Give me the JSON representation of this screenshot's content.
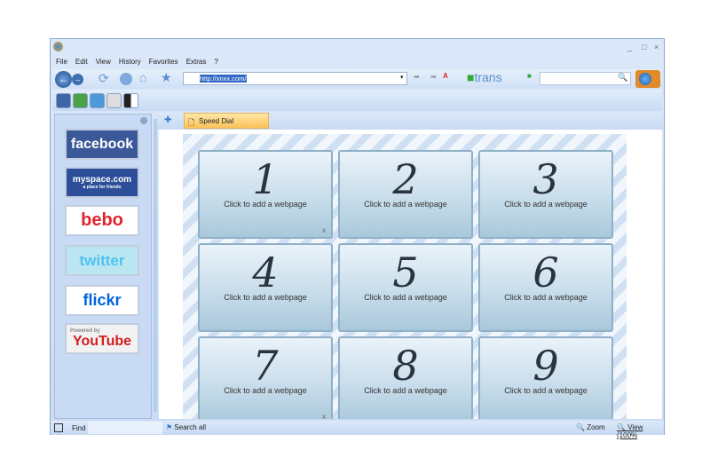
{
  "window": {
    "minimize": "_",
    "maximize": "□",
    "close": "×"
  },
  "menu": [
    "File",
    "Edit",
    "View",
    "History",
    "Favorites",
    "Extras",
    "?"
  ],
  "address": {
    "url": "http://xnxx.com/"
  },
  "toolbar": {
    "translate_label": "trans"
  },
  "tabs": [
    {
      "label": "Speed Dial"
    }
  ],
  "sidebar": {
    "items": [
      {
        "label": "facebook",
        "color": "#3b5998"
      },
      {
        "label": "myspace.com",
        "sub": "a place for friends",
        "color": "#2d4f9a"
      },
      {
        "label": "bebo",
        "color": "#e0242c"
      },
      {
        "label": "twitter",
        "color": "#4fc2ef"
      },
      {
        "label": "flickr",
        "color": "#0063dc"
      },
      {
        "label": "YouTube",
        "sub": "Powered by",
        "color": "#d1201f"
      }
    ]
  },
  "speed_dial": {
    "tiles": [
      {
        "number": "1",
        "label": "Click to add a webpage",
        "close": "x"
      },
      {
        "number": "2",
        "label": "Click to add a webpage"
      },
      {
        "number": "3",
        "label": "Click to add a webpage"
      },
      {
        "number": "4",
        "label": "Click to add a webpage"
      },
      {
        "number": "5",
        "label": "Click to add a webpage"
      },
      {
        "number": "6",
        "label": "Click to add a webpage"
      },
      {
        "number": "7",
        "label": "Click to add a webpage",
        "close": "x"
      },
      {
        "number": "8",
        "label": "Click to add a webpage"
      },
      {
        "number": "9",
        "label": "Click to add a webpage"
      }
    ]
  },
  "status": {
    "find": "Find",
    "search_all": "Search all",
    "zoom": "Zoom",
    "view": "View (100%"
  }
}
